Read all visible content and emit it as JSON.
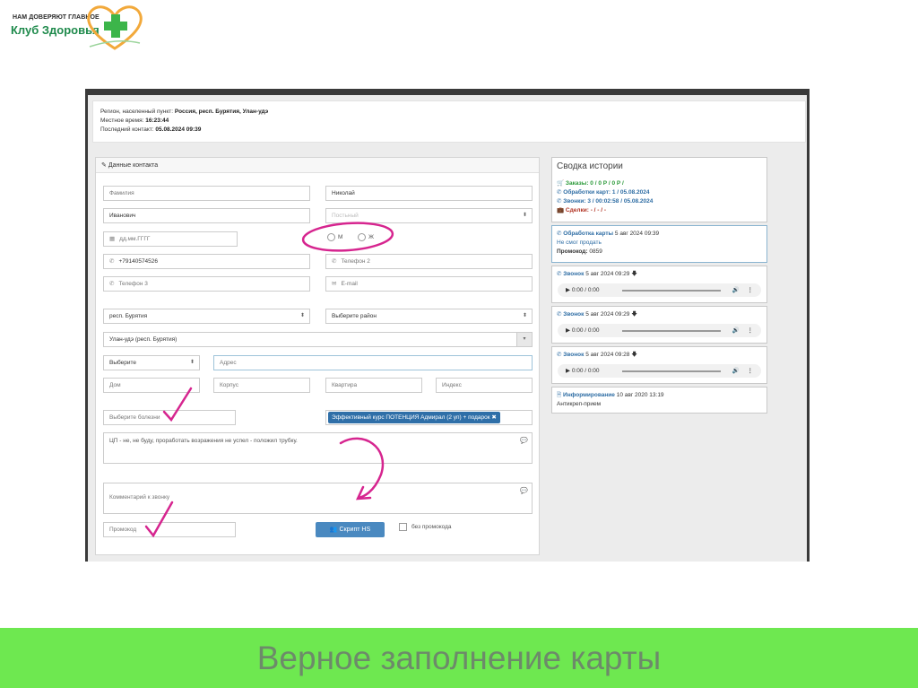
{
  "logo": {
    "tagline": "НАМ ДОВЕРЯЮТ ГЛАВНОЕ",
    "name": "Клуб Здоровья"
  },
  "info": {
    "region_label": "Регион, населенный пункт:",
    "region_value": "Россия, респ. Бурятия, Улан-удэ",
    "time_label": "Местное время:",
    "time_value": "16:23:44",
    "last_label": "Последний контакт:",
    "last_value": "05.08.2024 09:39"
  },
  "contact": {
    "title": "Данные контакта",
    "surname_placeholder": "Фамилия",
    "name_value": "Николай",
    "patronymic_value": "Иванович",
    "status_placeholder": "Постьный",
    "birthdate_placeholder": "дд.мм.ГГГГ",
    "gender_m": "М",
    "gender_f": "Ж",
    "phone1_value": "+79140574526",
    "phone2_placeholder": "Телефон 2",
    "phone3_placeholder": "Телефон 3",
    "email_placeholder": "E-mail",
    "region_select": "респ. Бурятия",
    "district_select": "Выберите район",
    "city_select": "Улан-удэ (респ. Бурятия)",
    "street_type_select": "Выберите",
    "address_placeholder": "Адрес",
    "house_placeholder": "Дом",
    "korpus_placeholder": "Корпус",
    "apartment_placeholder": "Квартира",
    "index_placeholder": "Индекс",
    "disease_placeholder": "Выберите болезни",
    "course_tag": "Эффективный курс ПОТЕНЦИЯ Адмирал (2 уп) + подарок",
    "note_text": "ЦП - не, не буду, проработать возражения не успел - положил трубку.",
    "call_comment_placeholder": "Комментарий к звонку",
    "promo_placeholder": "Промокод",
    "script_button": "Скрипт HS",
    "no_promo_label": "без промокода"
  },
  "history": {
    "title": "Сводка истории",
    "orders": "Заказы: 0 / 0 Р / 0 Р /",
    "card_processing": "Обработки карт: 1 / 05.08.2024",
    "calls": "Звонки: 3 / 00:02:58 / 05.08.2024",
    "deals": "Сделки: - / - / -",
    "entry1_title": "Обработка карты",
    "entry1_date": "5 авг 2024 09:39",
    "entry1_status": "Не смог продать",
    "entry1_promo_label": "Промокод:",
    "entry1_promo_value": "0859",
    "call_label": "Звонок",
    "call1_date": "5 авг 2024 09:29",
    "call2_date": "5 авг 2024 09:29",
    "call3_date": "5 авг 2024 09:28",
    "player_time": "0:00 / 0:00",
    "info_title": "Информирование",
    "info_date": "10 авг 2020 13:19",
    "info_text": "Антикреп-прием"
  },
  "footer": {
    "caption": "Верное заполнение карты"
  },
  "colors": {
    "footer_bg": "#6ee850",
    "caption": "#6d8a6a",
    "annotation": "#d6258f",
    "link_blue": "#2e6da4"
  }
}
